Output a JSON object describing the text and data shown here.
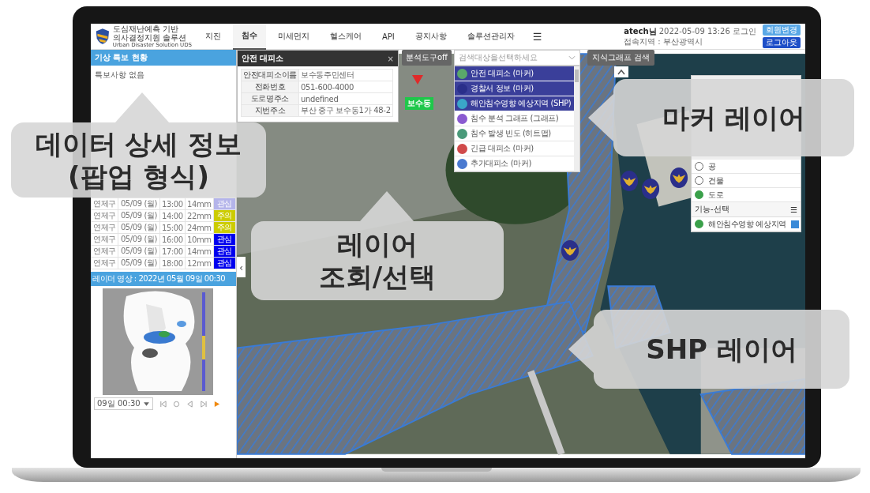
{
  "header": {
    "logo": [
      "도심재난예측 기반",
      "의사결정지원 솔루션",
      "Urban Disaster Solution UDS"
    ],
    "nav": [
      {
        "label": "지진",
        "selected": false
      },
      {
        "label": "침수",
        "selected": true
      },
      {
        "label": "미세먼지",
        "selected": false
      },
      {
        "label": "헬스케어",
        "selected": false
      },
      {
        "label": "API",
        "selected": false
      },
      {
        "label": "공지사항",
        "selected": false
      },
      {
        "label": "솔루션관리자",
        "selected": false
      }
    ],
    "menu": "☰",
    "user": {
      "name": "atech님",
      "login": "2022-05-09 13:26 로그인",
      "region": "접속지역 : 부산광역시"
    },
    "buttons": [
      {
        "label": "회원변경",
        "kind": "secondary"
      },
      {
        "label": "로그아웃",
        "kind": "primary"
      }
    ]
  },
  "weather": {
    "title": "기상 특보 현황",
    "notice": "특보사항 없음",
    "rows": [
      {
        "cells": [
          "연제구",
          "05/09 (월)",
          "13:00",
          "14mm"
        ],
        "level": "관심",
        "color": "#b4b4ea"
      },
      {
        "cells": [
          "연제구",
          "05/09 (월)",
          "14:00",
          "22mm"
        ],
        "level": "주의",
        "color": "#cccc00"
      },
      {
        "cells": [
          "연제구",
          "05/09 (월)",
          "15:00",
          "24mm"
        ],
        "level": "주의",
        "color": "#cccc00"
      },
      {
        "cells": [
          "연제구",
          "05/09 (월)",
          "16:00",
          "10mm"
        ],
        "level": "관심",
        "color": "#0000ee"
      },
      {
        "cells": [
          "연제구",
          "05/09 (월)",
          "17:00",
          "14mm"
        ],
        "level": "관심",
        "color": "#0000ee"
      },
      {
        "cells": [
          "연제구",
          "05/09 (월)",
          "18:00",
          "12mm"
        ],
        "level": "관심",
        "color": "#0000ee"
      }
    ]
  },
  "radar": {
    "title": "레이더 영상 : 2022년 05월 09일 00:30",
    "time": "09일 00:30"
  },
  "popup": {
    "title": "안전 대피소",
    "close": "×",
    "fields": [
      {
        "label": "안전대피소이름",
        "value": "보수동주민센터"
      },
      {
        "label": "전화번호",
        "value": "051-600-4000"
      },
      {
        "label": "도로명주소",
        "value": "undefined"
      },
      {
        "label": "지번주소",
        "value": "부산 중구 보수동1가 48-2"
      }
    ]
  },
  "toolbar": {
    "toggle": "분석도구off",
    "select_placeholder": "검색대상을선택하세요",
    "search_button": "지식그래프 검색"
  },
  "layers": [
    {
      "label": "안전 대피소 (마커)",
      "color": "#5aa86a",
      "selected": true
    },
    {
      "label": "경찰서 정보 (마커)",
      "color": "#2a2f8a",
      "selected": true
    },
    {
      "label": "해안침수영향 예상지역 (SHP)",
      "color": "#3aa6c8",
      "selected": true
    },
    {
      "label": "침수 분석 그래프 (그래프)",
      "color": "#8a5ad0",
      "selected": false
    },
    {
      "label": "침수 발생 빈도 (히트맵)",
      "color": "#4a9a7a",
      "selected": false
    },
    {
      "label": "긴급 대피소 (마커)",
      "color": "#d04a4a",
      "selected": false
    },
    {
      "label": "추가대피소 (마커)",
      "color": "#4a7ad0",
      "selected": false
    }
  ],
  "map_label": "보수동",
  "collapse_handle": "‹",
  "settings": {
    "toggles": [
      {
        "label": "공",
        "on": false
      },
      {
        "label": "건물",
        "on": false
      },
      {
        "label": "도로",
        "on": true
      }
    ],
    "section": "기능-선택",
    "menu": "☰",
    "functions": [
      {
        "label": "해안침수영향 예상지역",
        "on": true
      }
    ]
  },
  "callouts": [
    {
      "text": "데이터 상세 정보\n(팝업 형식)"
    },
    {
      "text": "마커 레이어"
    },
    {
      "text": "레이어\n조회/선택"
    },
    {
      "text": "SHP 레이어"
    }
  ]
}
